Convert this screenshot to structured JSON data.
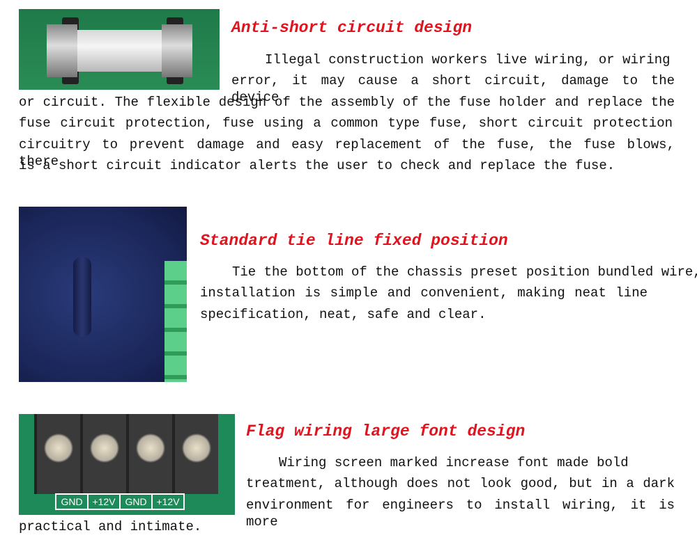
{
  "sections": [
    {
      "heading": "Anti-short circuit design",
      "lines": [
        "Illegal construction workers live wiring, or wiring",
        "error, it may cause a short circuit, damage to the device",
        "or circuit. The flexible design of the assembly of the fuse holder and replace the",
        "fuse circuit protection, fuse using a common type fuse, short circuit protection",
        "circuitry to prevent damage and easy replacement of the fuse, the fuse blows, there",
        "is a short circuit indicator alerts the user to check and replace the fuse."
      ]
    },
    {
      "heading": "Standard tie line fixed position",
      "lines": [
        "Tie the bottom of the chassis preset position bundled wire,",
        "installation is simple and convenient, making neat line",
        "specification, neat, safe and clear."
      ]
    },
    {
      "heading": "Flag wiring large font design",
      "lines": [
        "Wiring screen marked increase font made bold",
        "treatment, although does not look good, but in a dark",
        "environment for engineers to install wiring, it is more",
        "practical and intimate."
      ],
      "terminal_labels": [
        "GND",
        "+12V",
        "GND",
        "+12V"
      ]
    }
  ],
  "colors": {
    "heading": "#e0141e",
    "text": "#111111"
  }
}
